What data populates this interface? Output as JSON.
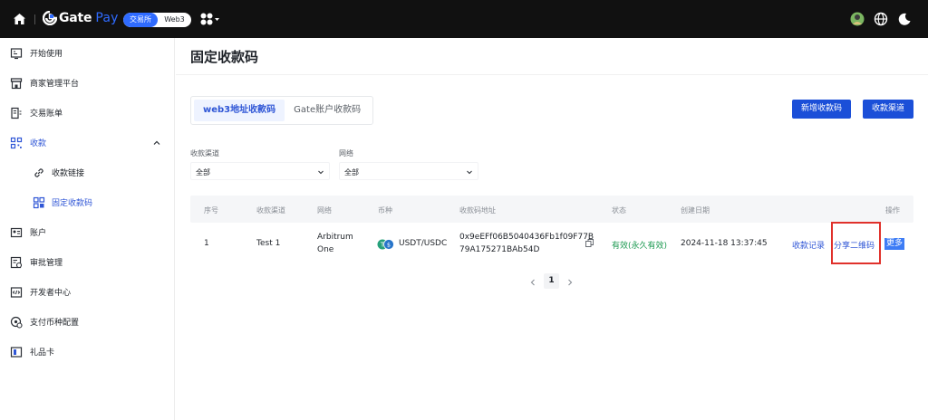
{
  "topbar": {
    "logo_text_main": "Gate",
    "logo_text_sub": "Pay",
    "switch_exchange": "交易所",
    "switch_web3": "Web3"
  },
  "sidebar": {
    "items": [
      {
        "label": "开始使用",
        "icon": "book-open-icon"
      },
      {
        "label": "商家管理平台",
        "icon": "store-icon"
      },
      {
        "label": "交易账单",
        "icon": "bill-icon"
      },
      {
        "label": "收款",
        "icon": "qr-grid-icon"
      },
      {
        "label": "收款链接",
        "icon": "link-icon"
      },
      {
        "label": "固定收款码",
        "icon": "qr-code-icon"
      },
      {
        "label": "账户",
        "icon": "id-card-icon"
      },
      {
        "label": "审批管理",
        "icon": "approval-icon"
      },
      {
        "label": "开发者中心",
        "icon": "code-icon"
      },
      {
        "label": "支付币种配置",
        "icon": "coin-settings-icon"
      },
      {
        "label": "礼品卡",
        "icon": "gift-card-icon"
      }
    ]
  },
  "main": {
    "title": "固定收款码",
    "tabs": [
      {
        "label": "web3地址收款码",
        "active": true
      },
      {
        "label": "Gate账户收款码",
        "active": false
      }
    ],
    "buttons": {
      "new_code": "新增收款码",
      "channels": "收款渠道"
    },
    "filters": {
      "channel_label": "收款渠道",
      "channel_value": "全部",
      "network_label": "网络",
      "network_value": "全部"
    },
    "table": {
      "headers": [
        "序号",
        "收款渠道",
        "网络",
        "币种",
        "收款码地址",
        "状态",
        "创建日期",
        "操作"
      ],
      "rows": [
        {
          "index": "1",
          "channel": "Test 1",
          "network_line1": "Arbitrum",
          "network_line2": "One",
          "currency": "USDT/USDC",
          "address_line1": "0x9eEFf06B5040436Fb1f09F77B",
          "address_line2": "79A175271BAb54D",
          "status": "有效(永久有效)",
          "created": "2024-11-18 13:37:45",
          "action_records": "收款记录",
          "action_share": "分享二维码",
          "action_more": "更多"
        }
      ]
    },
    "pagination": {
      "current": "1"
    }
  },
  "colors": {
    "accent": "#2f56d6",
    "primary_button": "#1b4fd8",
    "status_green": "#1e9a52",
    "highlight_red": "#e0312b"
  }
}
